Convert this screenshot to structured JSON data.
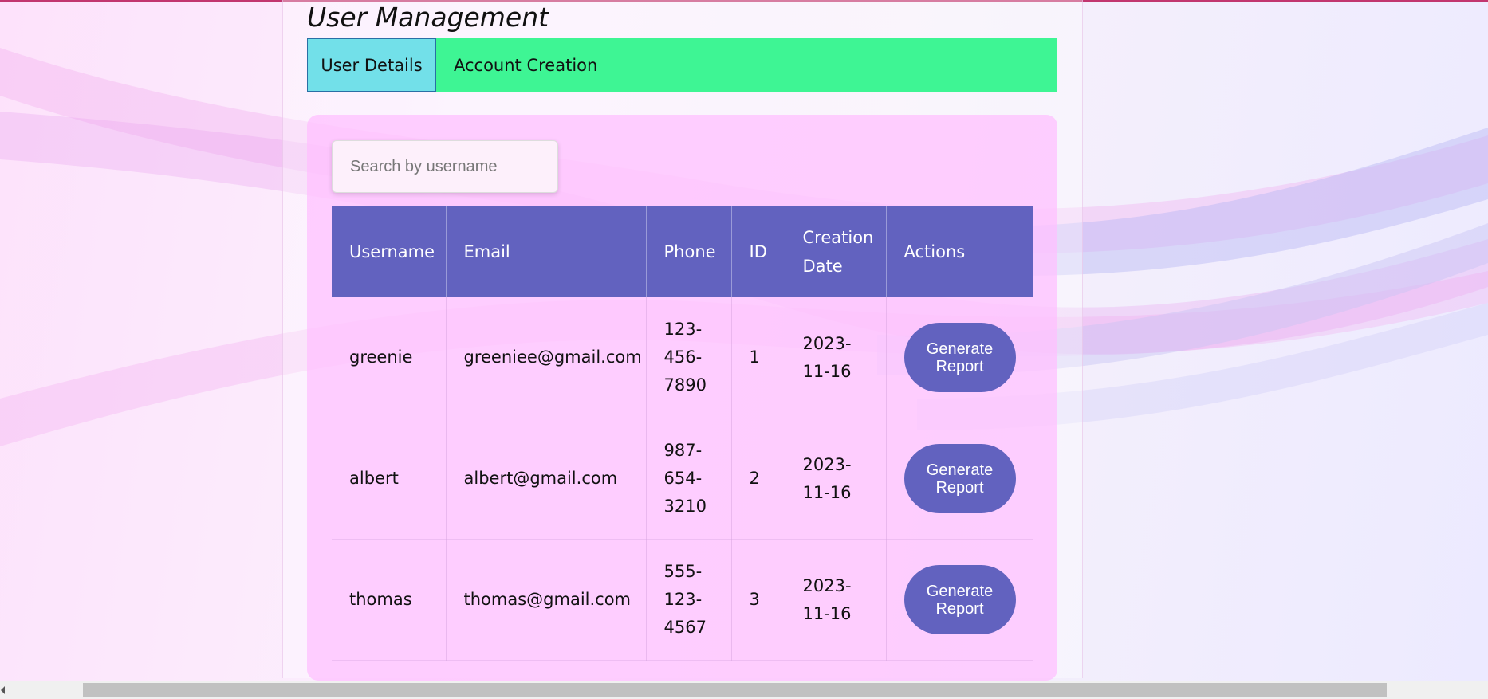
{
  "page": {
    "title": "User Management"
  },
  "tabs": [
    {
      "label": "User Details",
      "active": true
    },
    {
      "label": "Account Creation",
      "active": false
    }
  ],
  "search": {
    "placeholder": "Search by username",
    "value": ""
  },
  "table": {
    "columns": [
      "Username",
      "Email",
      "Phone",
      "ID",
      "Creation Date",
      "Actions"
    ],
    "rows": [
      {
        "username": "greenie",
        "email": "greeniee@gmail.com",
        "phone": "123-456-7890",
        "id": "1",
        "created": "2023-11-16",
        "action": "Generate Report"
      },
      {
        "username": "albert",
        "email": "albert@gmail.com",
        "phone": "987-654-3210",
        "id": "2",
        "created": "2023-11-16",
        "action": "Generate Report"
      },
      {
        "username": "thomas",
        "email": "thomas@gmail.com",
        "phone": "555-123-4567",
        "id": "3",
        "created": "2023-11-16",
        "action": "Generate Report"
      }
    ]
  },
  "colors": {
    "accent": "#6262bf",
    "tab_bar": "#3ef594",
    "tab_active": "#72e0e9",
    "card": "#ffbeff",
    "top_border": "#c2366f"
  }
}
